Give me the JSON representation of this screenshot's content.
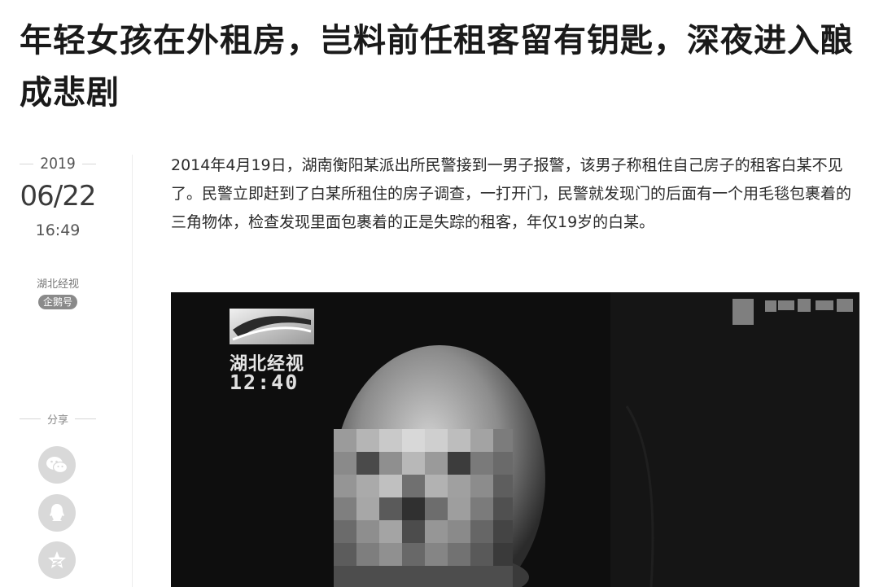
{
  "article": {
    "title": "年轻女孩在外租房，岂料前任租客留有钥匙，深夜进入酿成悲剧",
    "paragraph": "2014年4月19日，湖南衡阳某派出所民警接到一男子报警，该男子称租住自己房子的租客白某不见了。民警立即赶到了白某所租住的房子调查，一打开门，民警就发现门的后面有一个用毛毯包裹着的三角物体，检查发现里面包裹着的正是失踪的租客，年仅19岁的白某。"
  },
  "meta": {
    "year": "2019",
    "date": "06/22",
    "time": "16:49",
    "source": "湖北经视",
    "badge": "企鹅号"
  },
  "share": {
    "label": "分享",
    "buttons": [
      {
        "icon": "wechat-icon"
      },
      {
        "icon": "qq-icon"
      },
      {
        "icon": "qzone-star-icon"
      }
    ]
  },
  "image": {
    "channel_logo_text": "湖北经视",
    "timestamp_text": "12:40"
  }
}
